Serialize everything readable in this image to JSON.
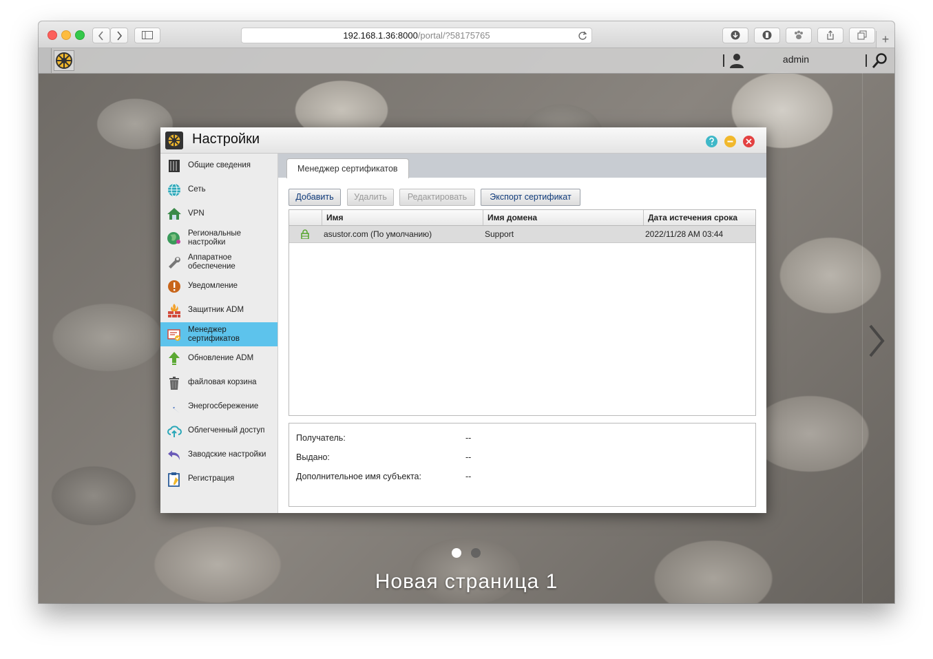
{
  "browser": {
    "address_host": "192.168.1.36:8000",
    "address_path": "/portal/?58175765"
  },
  "adm": {
    "username": "admin",
    "page_label": "Новая страница 1"
  },
  "window": {
    "title": "Настройки"
  },
  "sidebar": {
    "items": [
      {
        "label": "Общие сведения",
        "icon": "server-icon"
      },
      {
        "label": "Сеть",
        "icon": "globe-icon"
      },
      {
        "label": "VPN",
        "icon": "vpn-icon"
      },
      {
        "label": "Региональные настройки",
        "icon": "globe-pin-icon"
      },
      {
        "label": "Аппаратное обеспечение",
        "icon": "wrench-icon"
      },
      {
        "label": "Уведомление",
        "icon": "alert-icon"
      },
      {
        "label": "Защитник ADM",
        "icon": "firewall-icon"
      },
      {
        "label": "Менеджер сертификатов",
        "icon": "certificate-icon"
      },
      {
        "label": "Обновление ADM",
        "icon": "upload-arrow-icon"
      },
      {
        "label": "файловая корзина",
        "icon": "trash-icon"
      },
      {
        "label": "Энергосбережение",
        "icon": "lightning-icon"
      },
      {
        "label": "Облегченный доступ",
        "icon": "cloud-upload-icon"
      },
      {
        "label": "Заводские настройки",
        "icon": "undo-icon"
      },
      {
        "label": "Регистрация",
        "icon": "clipboard-icon"
      }
    ],
    "active_index": 7
  },
  "tab": {
    "label": "Менеджер сертификатов"
  },
  "toolbar": {
    "add_label": "Добавить",
    "delete_label": "Удалить",
    "edit_label": "Редактировать",
    "export_label": "Экспорт сертификат"
  },
  "table": {
    "columns": [
      "Имя",
      "Имя домена",
      "Дата истечения срока"
    ],
    "rows": [
      {
        "name": "asustor.com (По умолчанию)",
        "domain": "Support",
        "expiry": "2022/11/28 AM 03:44"
      }
    ]
  },
  "details": {
    "recipient_label": "Получатель:",
    "recipient_value": "--",
    "issued_label": "Выдано:",
    "issued_value": "--",
    "alt_name_label": "Дополнительное имя субъекта:",
    "alt_name_value": "--"
  },
  "colors": {
    "active_item": "#5dc3ec",
    "accent_text": "#0f3a7a"
  }
}
